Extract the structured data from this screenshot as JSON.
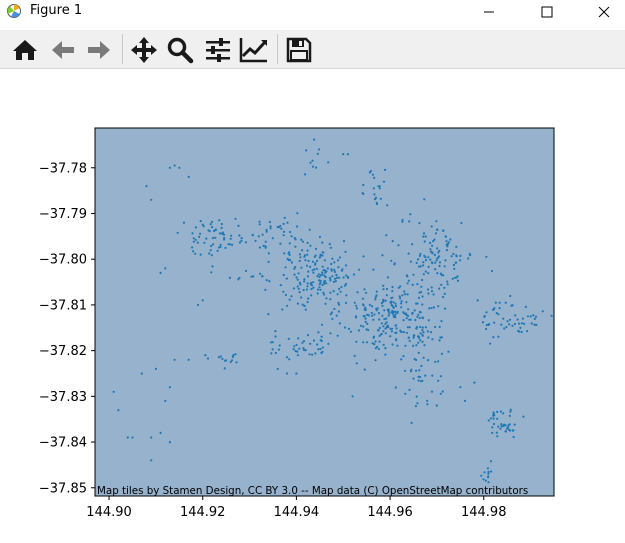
{
  "window": {
    "title": "Figure 1",
    "app_icon": "matplotlib-icon",
    "buttons": [
      "minimize-icon",
      "maximize-icon",
      "close-icon"
    ]
  },
  "toolbar": {
    "items": [
      {
        "name": "home-button",
        "icon": "home-icon"
      },
      {
        "name": "back-button",
        "icon": "arrow-left-icon"
      },
      {
        "name": "forward-button",
        "icon": "arrow-right-icon"
      },
      {
        "name": "pan-button",
        "icon": "move-icon"
      },
      {
        "name": "zoom-button",
        "icon": "zoom-icon"
      },
      {
        "name": "subplots-button",
        "icon": "sliders-icon"
      },
      {
        "name": "customize-button",
        "icon": "chart-edit-icon"
      },
      {
        "name": "save-button",
        "icon": "floppy-disk-icon"
      }
    ]
  },
  "chart_data": {
    "type": "scatter",
    "title": "",
    "xlabel": "",
    "ylabel": "",
    "xlim": [
      144.897,
      144.995
    ],
    "ylim": [
      -37.8518,
      -37.7713
    ],
    "xticks": [
      144.9,
      144.92,
      144.94,
      144.96,
      144.98
    ],
    "xtick_labels": [
      "144.90",
      "144.92",
      "144.94",
      "144.96",
      "144.98"
    ],
    "yticks": [
      -37.78,
      -37.79,
      -37.8,
      -37.81,
      -37.82,
      -37.83,
      -37.84,
      -37.85
    ],
    "ytick_labels": [
      "−37.78",
      "−37.79",
      "−37.80",
      "−37.81",
      "−37.82",
      "−37.83",
      "−37.84",
      "−37.85"
    ],
    "background_color": "#97b2cc",
    "marker_color": "#1f77b4",
    "grid": false,
    "attribution": "Map tiles by Stamen Design, CC BY 3.0 -- Map data (C) OpenStreetMap contributors",
    "clusters": [
      {
        "cx": 144.961,
        "cy": -37.8125,
        "sx": 0.0055,
        "sy": 0.0045,
        "n": 260
      },
      {
        "cx": 144.945,
        "cy": -37.8035,
        "sx": 0.0045,
        "sy": 0.0038,
        "n": 170
      },
      {
        "cx": 144.97,
        "cy": -37.799,
        "sx": 0.004,
        "sy": 0.004,
        "n": 110
      },
      {
        "cx": 144.923,
        "cy": -37.795,
        "sx": 0.0045,
        "sy": 0.002,
        "n": 65
      },
      {
        "cx": 144.936,
        "cy": -37.795,
        "sx": 0.003,
        "sy": 0.002,
        "n": 40
      },
      {
        "cx": 144.942,
        "cy": -37.819,
        "sx": 0.0045,
        "sy": 0.0018,
        "n": 45
      },
      {
        "cx": 144.986,
        "cy": -37.813,
        "sx": 0.003,
        "sy": 0.0022,
        "n": 55
      },
      {
        "cx": 144.984,
        "cy": -37.836,
        "sx": 0.002,
        "sy": 0.0015,
        "n": 40
      },
      {
        "cx": 144.957,
        "cy": -37.783,
        "sx": 0.002,
        "sy": 0.003,
        "n": 20
      },
      {
        "cx": 144.944,
        "cy": -37.779,
        "sx": 0.0015,
        "sy": 0.002,
        "n": 10
      },
      {
        "cx": 144.967,
        "cy": -37.826,
        "sx": 0.0025,
        "sy": 0.0035,
        "n": 35
      },
      {
        "cx": 144.925,
        "cy": -37.822,
        "sx": 0.003,
        "sy": 0.0008,
        "n": 14
      },
      {
        "cx": 144.928,
        "cy": -37.804,
        "sx": 0.003,
        "sy": 0.001,
        "n": 10
      },
      {
        "cx": 144.981,
        "cy": -37.847,
        "sx": 0.0015,
        "sy": 0.001,
        "n": 12
      }
    ],
    "points": [
      [
        144.901,
        -37.829
      ],
      [
        144.902,
        -37.833
      ],
      [
        144.905,
        -37.839
      ],
      [
        144.904,
        -37.839
      ],
      [
        144.909,
        -37.839
      ],
      [
        144.911,
        -37.838
      ],
      [
        144.913,
        -37.84
      ],
      [
        144.909,
        -37.844
      ],
      [
        144.907,
        -37.825
      ],
      [
        144.91,
        -37.824
      ],
      [
        144.913,
        -37.828
      ],
      [
        144.912,
        -37.831
      ],
      [
        144.914,
        -37.822
      ],
      [
        144.917,
        -37.822
      ],
      [
        144.909,
        -37.787
      ],
      [
        144.908,
        -37.784
      ],
      [
        144.913,
        -37.78
      ],
      [
        144.915,
        -37.78
      ],
      [
        144.914,
        -37.7795
      ],
      [
        144.917,
        -37.782
      ],
      [
        144.911,
        -37.803
      ],
      [
        144.912,
        -37.802
      ],
      [
        144.936,
        -37.824
      ],
      [
        144.938,
        -37.825
      ],
      [
        144.94,
        -37.825
      ],
      [
        144.952,
        -37.83
      ],
      [
        144.975,
        -37.828
      ],
      [
        144.976,
        -37.831
      ],
      [
        144.978,
        -37.827
      ],
      [
        144.95,
        -37.777
      ],
      [
        144.951,
        -37.777
      ],
      [
        144.934,
        -37.812
      ],
      [
        144.937,
        -37.811
      ],
      [
        144.92,
        -37.809
      ],
      [
        144.919,
        -37.81
      ]
    ]
  }
}
